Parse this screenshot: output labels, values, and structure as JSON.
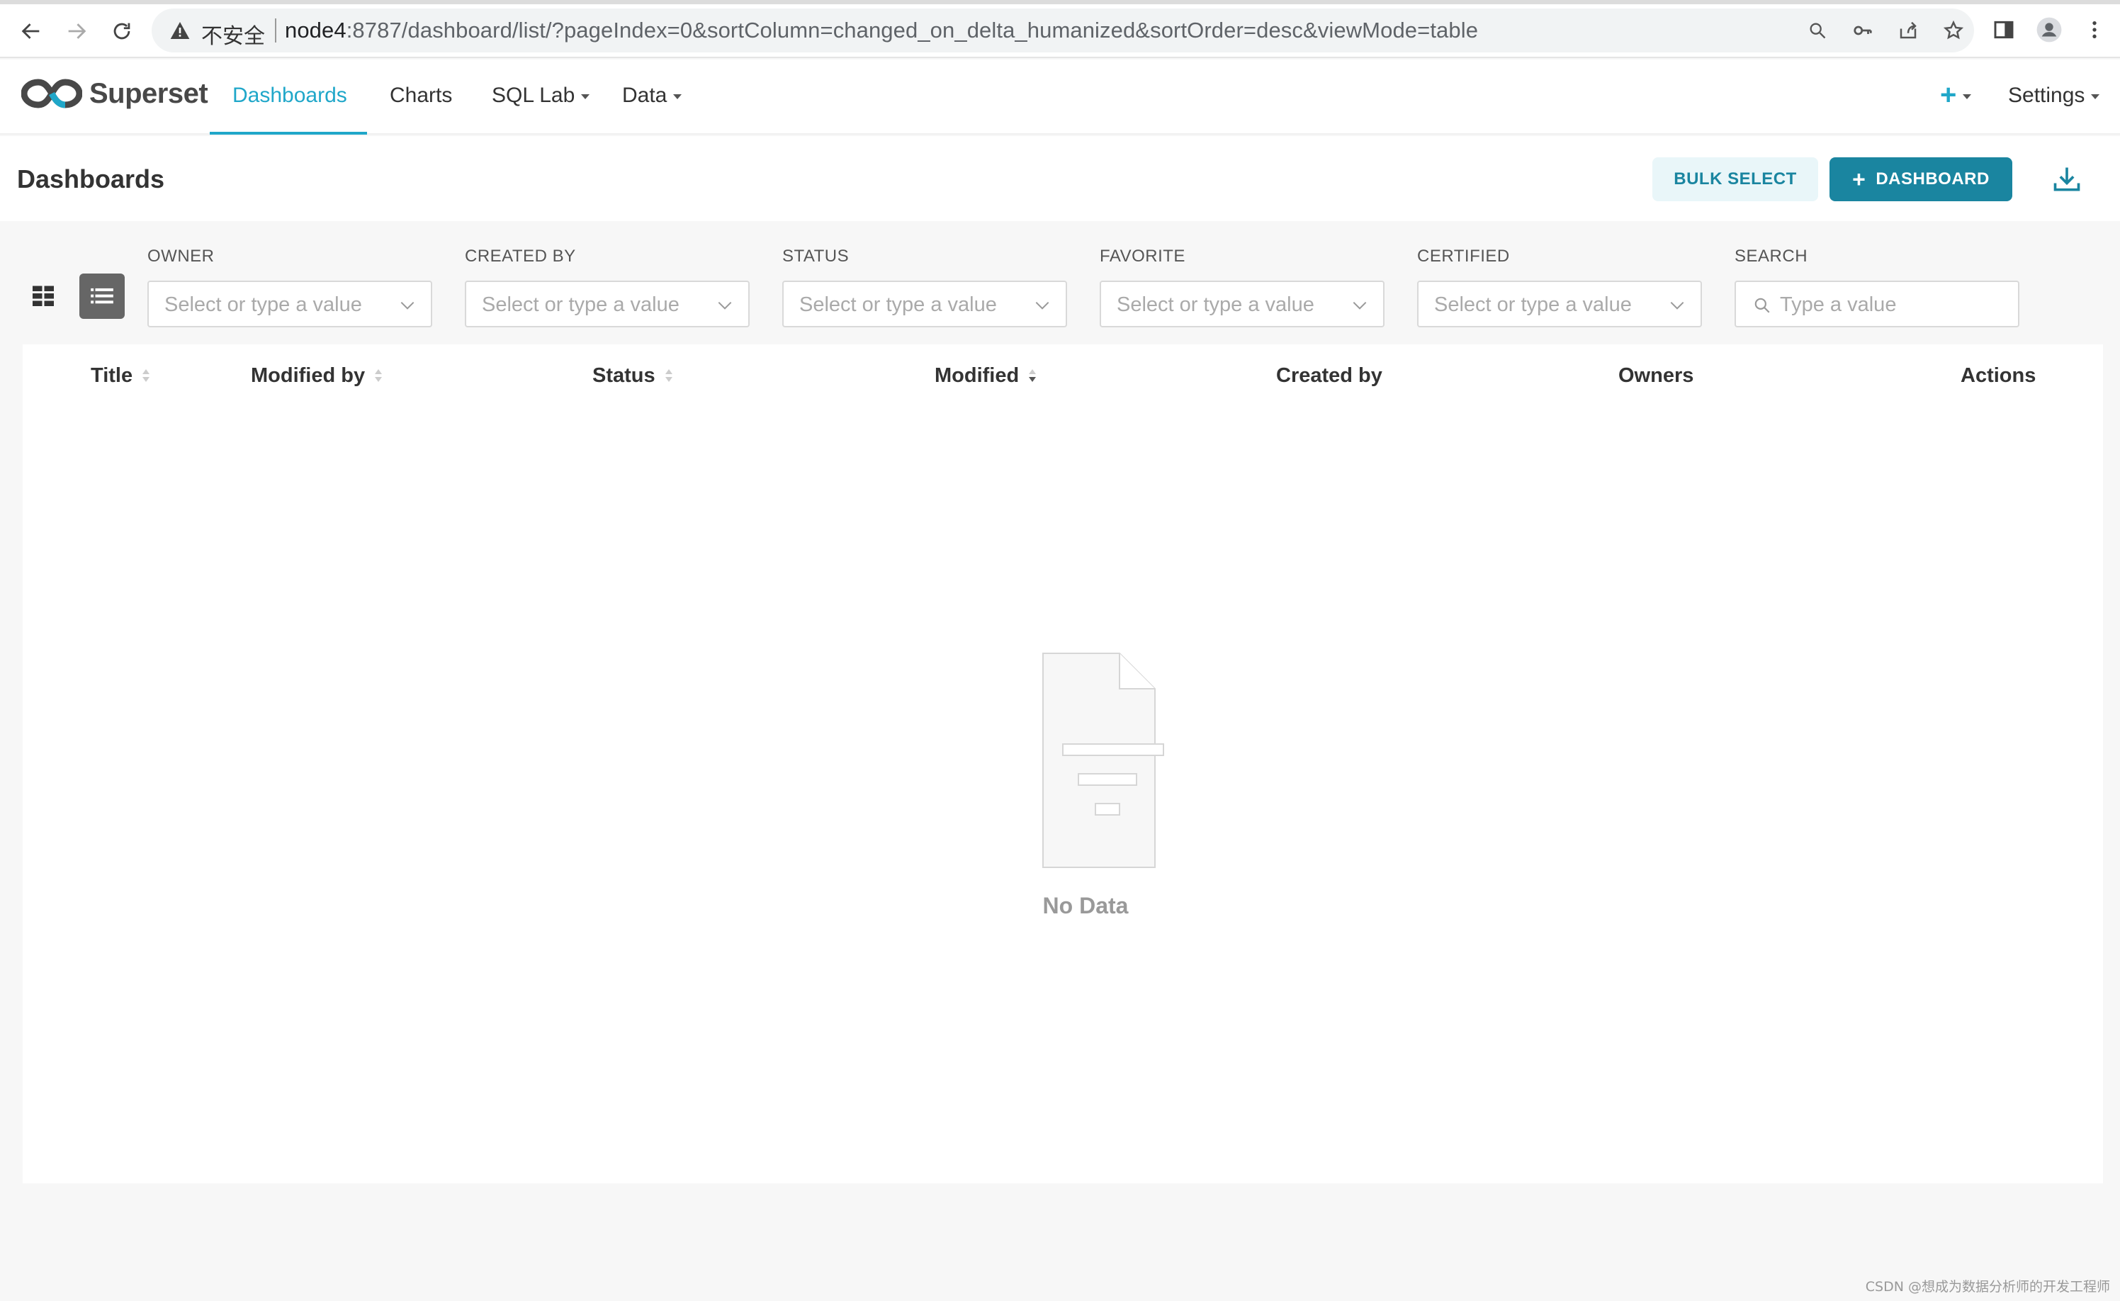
{
  "browser": {
    "insecure_label": "不安全",
    "url_host": "node4",
    "url_rest": ":8787/dashboard/list/?pageIndex=0&sortColumn=changed_on_delta_humanized&sortOrder=desc&viewMode=table"
  },
  "brand": {
    "name": "Superset",
    "accent": "#20a7c9",
    "primary_button": "#1a85a0"
  },
  "menu": {
    "dashboards": "Dashboards",
    "charts": "Charts",
    "sql_lab": "SQL Lab",
    "data": "Data",
    "settings": "Settings"
  },
  "subheader": {
    "title": "Dashboards",
    "bulk_select": "BULK SELECT",
    "add_dashboard": "DASHBOARD"
  },
  "filters": {
    "owner": {
      "label": "OWNER",
      "placeholder": "Select or type a value"
    },
    "created_by": {
      "label": "CREATED BY",
      "placeholder": "Select or type a value"
    },
    "status": {
      "label": "STATUS",
      "placeholder": "Select or type a value"
    },
    "favorite": {
      "label": "FAVORITE",
      "placeholder": "Select or type a value"
    },
    "certified": {
      "label": "CERTIFIED",
      "placeholder": "Select or type a value"
    },
    "search": {
      "label": "SEARCH",
      "placeholder": "Type a value"
    }
  },
  "table": {
    "columns": {
      "title": "Title",
      "modified_by": "Modified by",
      "status": "Status",
      "modified": "Modified",
      "created_by": "Created by",
      "owners": "Owners",
      "actions": "Actions"
    },
    "empty_text": "No Data"
  },
  "watermark": "CSDN @想成为数据分析师的开发工程师"
}
